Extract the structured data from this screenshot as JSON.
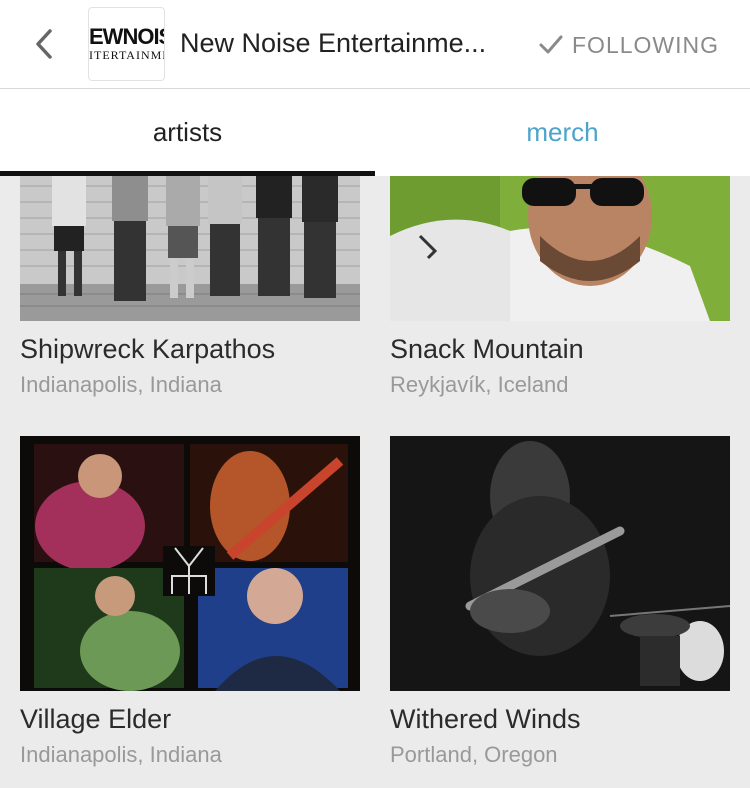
{
  "header": {
    "back_icon": "chevron-left-icon",
    "logo": {
      "line1": "EWNOIS",
      "line2": "ITERTAINMEN"
    },
    "title": "New Noise Entertainme...",
    "follow_icon": "checkmark-icon",
    "follow_label": "FOLLOWING"
  },
  "tabs": [
    {
      "label": "artists",
      "active": true
    },
    {
      "label": "merch",
      "active": false
    }
  ],
  "colors": {
    "accent": "#4da3c9",
    "active_tab_underline": "#111111",
    "background": "#ebebeb"
  },
  "artists": [
    {
      "name": "Shipwreck Karpathos",
      "location": "Indianapolis, Indiana"
    },
    {
      "name": "Snack Mountain",
      "location": "Reykjavík, Iceland"
    },
    {
      "name": "Village Elder",
      "location": "Indianapolis, Indiana"
    },
    {
      "name": "Withered Winds",
      "location": "Portland, Oregon"
    }
  ]
}
